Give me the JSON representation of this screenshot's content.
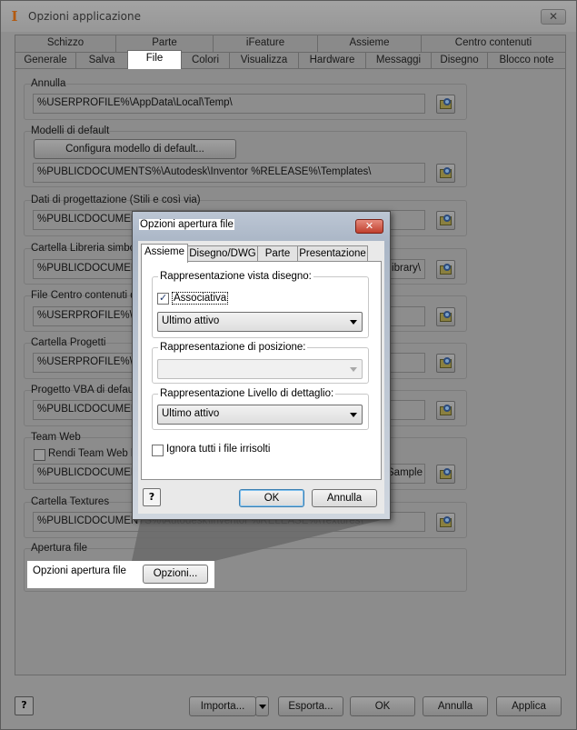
{
  "window": {
    "title": "Opzioni applicazione",
    "close_label": "✕",
    "app_icon": "I"
  },
  "tabs": {
    "row1": [
      "Schizzo",
      "Parte",
      "iFeature",
      "Assieme",
      "Centro contenuti"
    ],
    "row2": [
      "Generale",
      "Salva",
      "File",
      "Colori",
      "Visualizza",
      "Hardware",
      "Messaggi",
      "Disegno",
      "Blocco note"
    ],
    "active": "File"
  },
  "sections": {
    "annulla": {
      "label": "Annulla",
      "path": "%USERPROFILE%\\AppData\\Local\\Temp\\"
    },
    "modelli": {
      "label": "Modelli di default",
      "button": "Configura modello di default...",
      "path": "%PUBLICDOCUMENTS%\\Autodesk\\Inventor %RELEASE%\\Templates\\"
    },
    "dati": {
      "label": "Dati di progettazione (Stili e così via)",
      "path": "%PUBLICDOCUMENT"
    },
    "libreria": {
      "label": "Cartella Libreria simbo",
      "path": "%PUBLICDOCUMENT",
      "path_tail": "ibrary\\"
    },
    "centro": {
      "label": "File Centro contenuti d",
      "path": "%USERPROFILE%\\D"
    },
    "progetti": {
      "label": "Cartella Progetti",
      "path": "%USERPROFILE%\\D"
    },
    "vba": {
      "label": "Progetto VBA di defau",
      "path": "%PUBLICDOCUMENT"
    },
    "teamweb": {
      "label": "Team Web",
      "checkbox": "Rendi Team Web la",
      "path": "%PUBLICDOCUMENT",
      "path_tail": "oSample"
    },
    "textures": {
      "label": "Cartella Textures",
      "path": "%PUBLICDOCUMENTS%\\Autodesk\\Inventor %RELEASE%\\Textures\\"
    },
    "apertura": {
      "label": "Apertura file",
      "row_label": "Opzioni apertura file",
      "button": "Opzioni..."
    }
  },
  "footer": {
    "help": "?",
    "importa": "Importa...",
    "esporta": "Esporta...",
    "ok": "OK",
    "annulla": "Annulla",
    "applica": "Applica"
  },
  "dialog": {
    "title": "Opzioni apertura file",
    "close_label": "✕",
    "tabs": [
      "Assieme",
      "Disegno/DWG",
      "Parte",
      "Presentazione"
    ],
    "active_tab": "Assieme",
    "vista_label": "Rappresentazione vista disegno:",
    "associativa": "Associativa",
    "associativa_checked": true,
    "vista_value": "Ultimo attivo",
    "posizione_label": "Rappresentazione di posizione:",
    "posizione_value": "",
    "livello_label": "Rappresentazione Livello di dettaglio:",
    "livello_value": "Ultimo attivo",
    "ignora": "Ignora tutti i file irrisolti",
    "help": "?",
    "ok": "OK",
    "annulla": "Annulla"
  },
  "colors": {
    "highlight": "#ffffff",
    "dialog_close": "#c0402e",
    "default_button_border": "#3c7fb1"
  }
}
